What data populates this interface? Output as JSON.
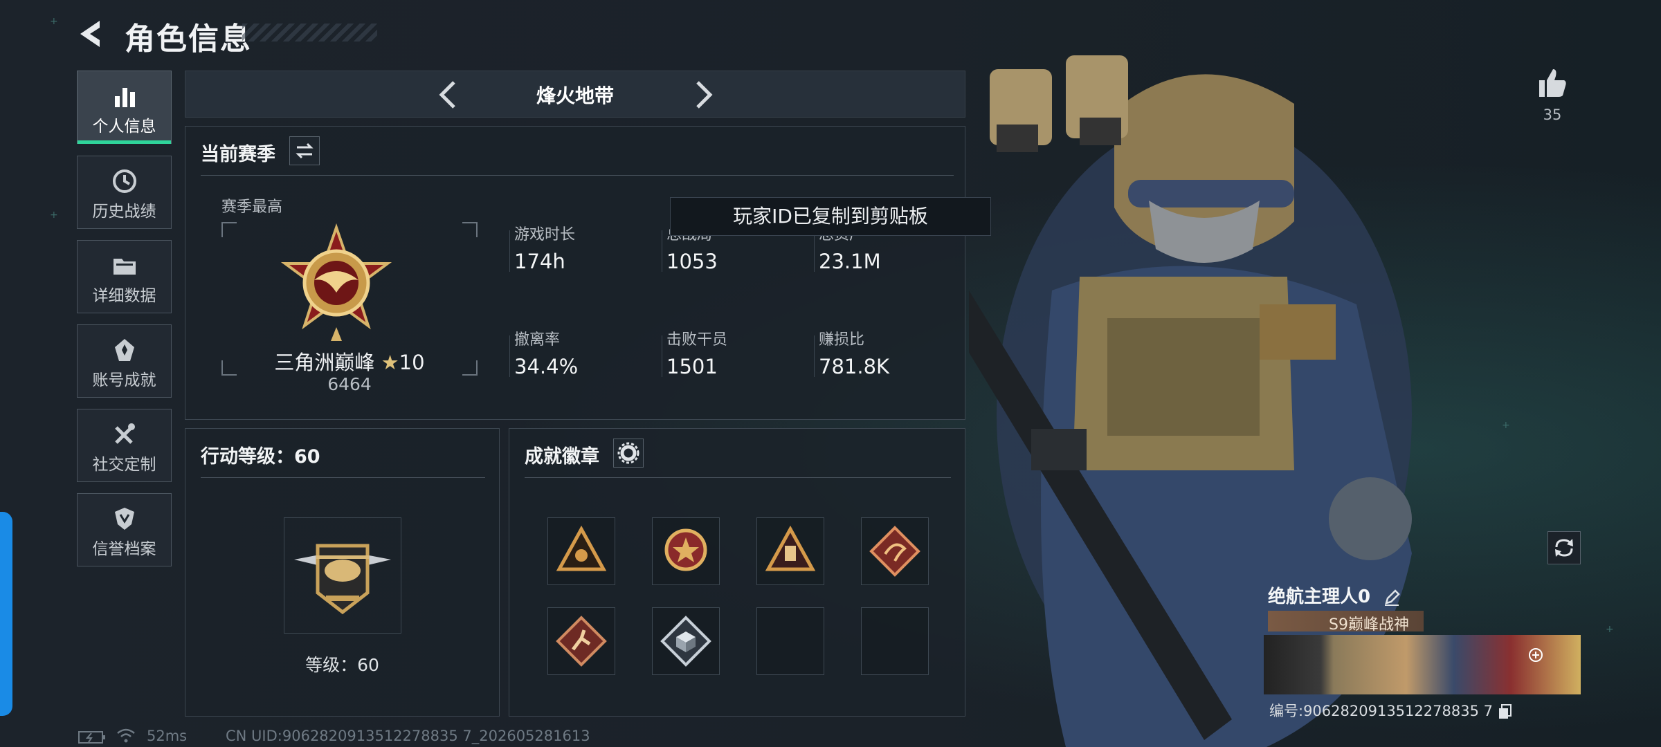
{
  "header": {
    "title": "角色信息",
    "back_icon": "back-arrow-icon"
  },
  "sidebar": {
    "items": [
      {
        "label": "个人信息",
        "icon": "bar-chart-icon",
        "active": true
      },
      {
        "label": "历史战绩",
        "icon": "clock-icon",
        "active": false
      },
      {
        "label": "详细数据",
        "icon": "folder-icon",
        "active": false
      },
      {
        "label": "账号成就",
        "icon": "medal-icon",
        "active": false
      },
      {
        "label": "社交定制",
        "icon": "tools-icon",
        "active": false
      },
      {
        "label": "信誉档案",
        "icon": "shield-icon",
        "active": false
      }
    ]
  },
  "mode_tabs": {
    "current": "烽火地带"
  },
  "season": {
    "title": "当前赛季",
    "best_label": "赛季最高",
    "rank_name": "三角洲巅峰",
    "rank_stars": "10",
    "rank_score": "6464",
    "stats": [
      {
        "label": "游戏时长",
        "value": "174h"
      },
      {
        "label": "总战局",
        "value": "1053"
      },
      {
        "label": "总资产",
        "value": "23.1M"
      },
      {
        "label": "撤离率",
        "value": "34.4%"
      },
      {
        "label": "击败干员",
        "value": "1501"
      },
      {
        "label": "赚损比",
        "value": "781.8K"
      }
    ]
  },
  "toast": "玩家ID已复制到剪贴板",
  "action_level": {
    "title": "行动等级：60",
    "level_text": "等级：60"
  },
  "achievements": {
    "title": "成就徽章",
    "slots_filled": 6,
    "slots_total": 8
  },
  "profile": {
    "likes": "35",
    "player_name": "绝航主理人0",
    "title_tag": "S9巅峰战神",
    "id_text": "编号:9062820913512278835 7"
  },
  "status_bar": {
    "ping": "52ms",
    "uid": "CN UID:9062820913512278835 7_202605281613"
  },
  "colors": {
    "accent": "#2fd49a",
    "blue_edge": "#1a8be6"
  }
}
